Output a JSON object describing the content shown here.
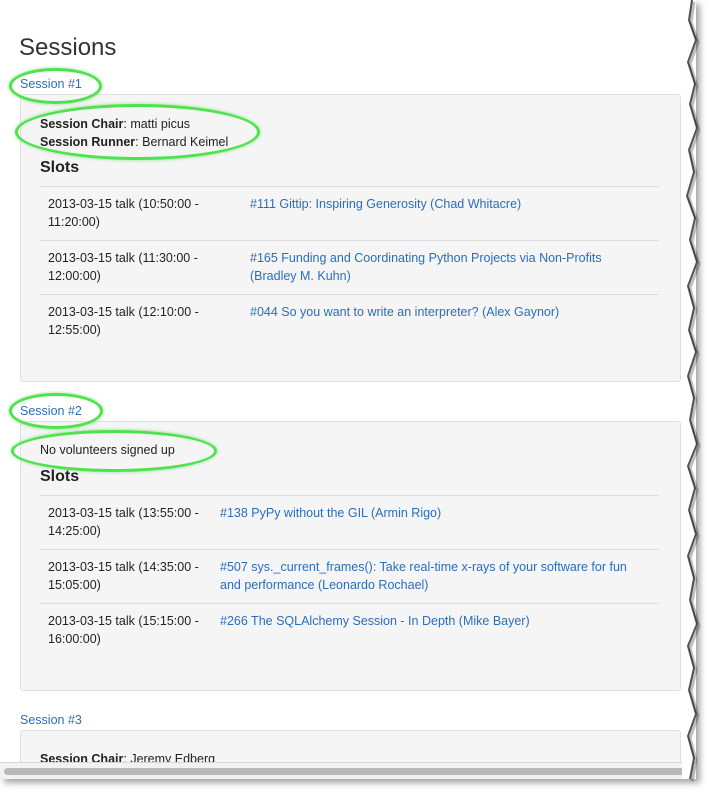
{
  "page": {
    "title": "Sessions"
  },
  "sessions": [
    {
      "link": "Session #1",
      "chair_label": "Session Chair",
      "chair": ": matti picus",
      "runner_label": "Session Runner",
      "runner": ": Bernard Keimel",
      "slots_title": "Slots",
      "slots": [
        {
          "time": "2013-03-15 talk (10:50:00 - 11:20:00)",
          "talk": "#111 Gittip: Inspiring Generosity (Chad Whitacre)"
        },
        {
          "time": "2013-03-15 talk (11:30:00 - 12:00:00)",
          "talk": "#165 Funding and Coordinating Python Projects via Non-Profits (Bradley M. Kuhn)"
        },
        {
          "time": "2013-03-15 talk (12:10:00 - 12:55:00)",
          "talk": "#044 So you want to write an interpreter? (Alex Gaynor)"
        }
      ]
    },
    {
      "link": "Session #2",
      "no_volunteers": "No volunteers signed up",
      "slots_title": "Slots",
      "slots": [
        {
          "time": "2013-03-15 talk (13:55:00 - 14:25:00)",
          "talk": "#138 PyPy without the GIL (Armin Rigo)"
        },
        {
          "time": "2013-03-15 talk (14:35:00 - 15:05:00)",
          "talk": "#507 sys._current_frames(): Take real-time x-rays of your software for fun and performance (Leonardo Rochael)"
        },
        {
          "time": "2013-03-15 talk (15:15:00 - 16:00:00)",
          "talk": "#266 The SQLAlchemy Session - In Depth (Mike Bayer)"
        }
      ]
    },
    {
      "link": "Session #3",
      "chair_label": "Session Chair",
      "chair": ": Jeremy Edberg"
    }
  ],
  "colors": {
    "link": "#2a6ebb",
    "highlight": "#4de34d",
    "well": "#f5f5f5"
  }
}
